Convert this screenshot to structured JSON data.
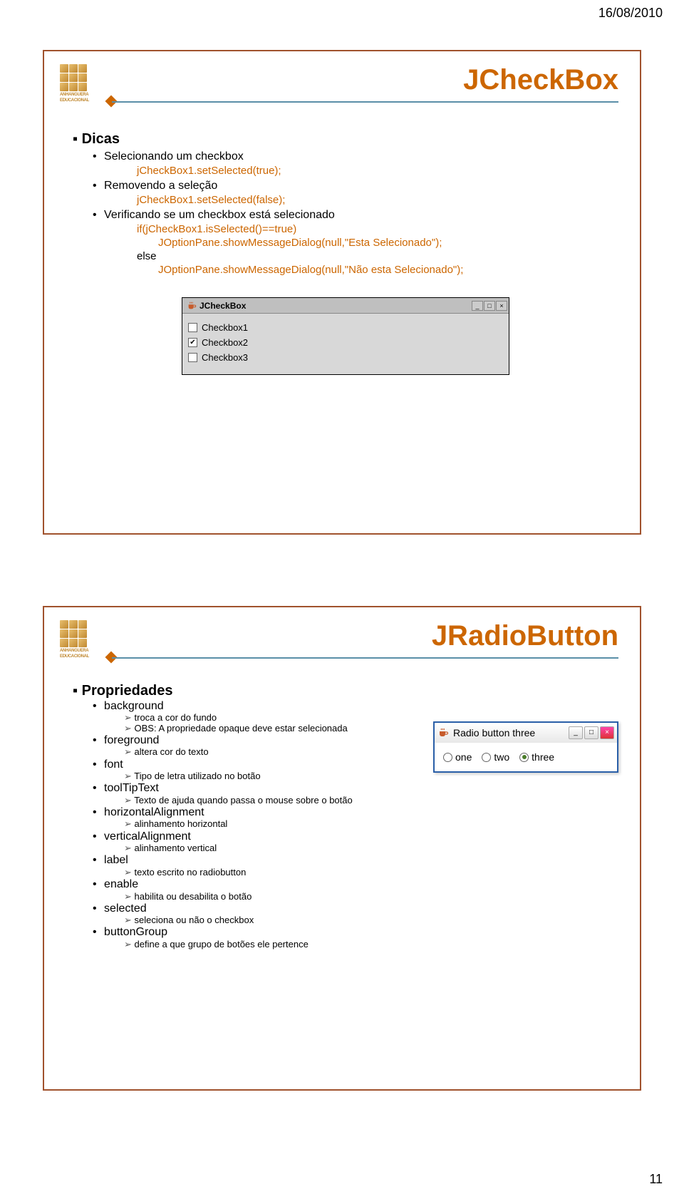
{
  "header": {
    "date": "16/08/2010",
    "page_number": "11"
  },
  "logo_text": {
    "line1": "ANHANGUERA",
    "line2": "EDUCACIONAL"
  },
  "slide1": {
    "title": "JCheckBox",
    "section": "Dicas",
    "items": {
      "select_label": "Selecionando um checkbox",
      "select_code": "jCheckBox1.setSelected(true);",
      "remove_label": "Removendo a seleção",
      "remove_code": "jCheckBox1.setSelected(false);",
      "verify_label": "Verificando se um checkbox está selecionado",
      "verify_if": "if(jCheckBox1.isSelected()==true)",
      "verify_true": "JOptionPane.showMessageDialog(null,\"Esta Selecionado\");",
      "verify_else": "else",
      "verify_false": "JOptionPane.showMessageDialog(null,\"Não esta Selecionado\");"
    },
    "window": {
      "title": "JCheckBox",
      "checks": [
        {
          "label": "Checkbox1",
          "checked": false
        },
        {
          "label": "Checkbox2",
          "checked": true
        },
        {
          "label": "Checkbox3",
          "checked": false
        }
      ]
    }
  },
  "slide2": {
    "title": "JRadioButton",
    "section": "Propriedades",
    "props": [
      {
        "name": "background",
        "subs": [
          "troca a cor do fundo",
          "OBS: A propriedade opaque deve estar selecionada"
        ]
      },
      {
        "name": "foreground",
        "subs": [
          "altera cor do texto"
        ]
      },
      {
        "name": "font",
        "subs": [
          "Tipo de letra utilizado no botão"
        ]
      },
      {
        "name": "toolTipText",
        "subs": [
          "Texto de ajuda quando passa o mouse sobre o botão"
        ]
      },
      {
        "name": "horizontalAlignment",
        "subs": [
          "alinhamento horizontal"
        ]
      },
      {
        "name": "verticalAlignment",
        "subs": [
          "alinhamento vertical"
        ]
      },
      {
        "name": "label",
        "subs": [
          "texto escrito no radiobutton"
        ]
      },
      {
        "name": "enable",
        "subs": [
          "habilita ou desabilita o botão"
        ]
      },
      {
        "name": "selected",
        "subs": [
          "seleciona ou não o checkbox"
        ]
      },
      {
        "name": "buttonGroup",
        "subs": [
          "define a que grupo de botões ele pertence"
        ]
      }
    ],
    "window": {
      "title": "Radio button three",
      "options": [
        {
          "label": "one",
          "selected": false
        },
        {
          "label": "two",
          "selected": false
        },
        {
          "label": "three",
          "selected": true
        }
      ]
    }
  }
}
